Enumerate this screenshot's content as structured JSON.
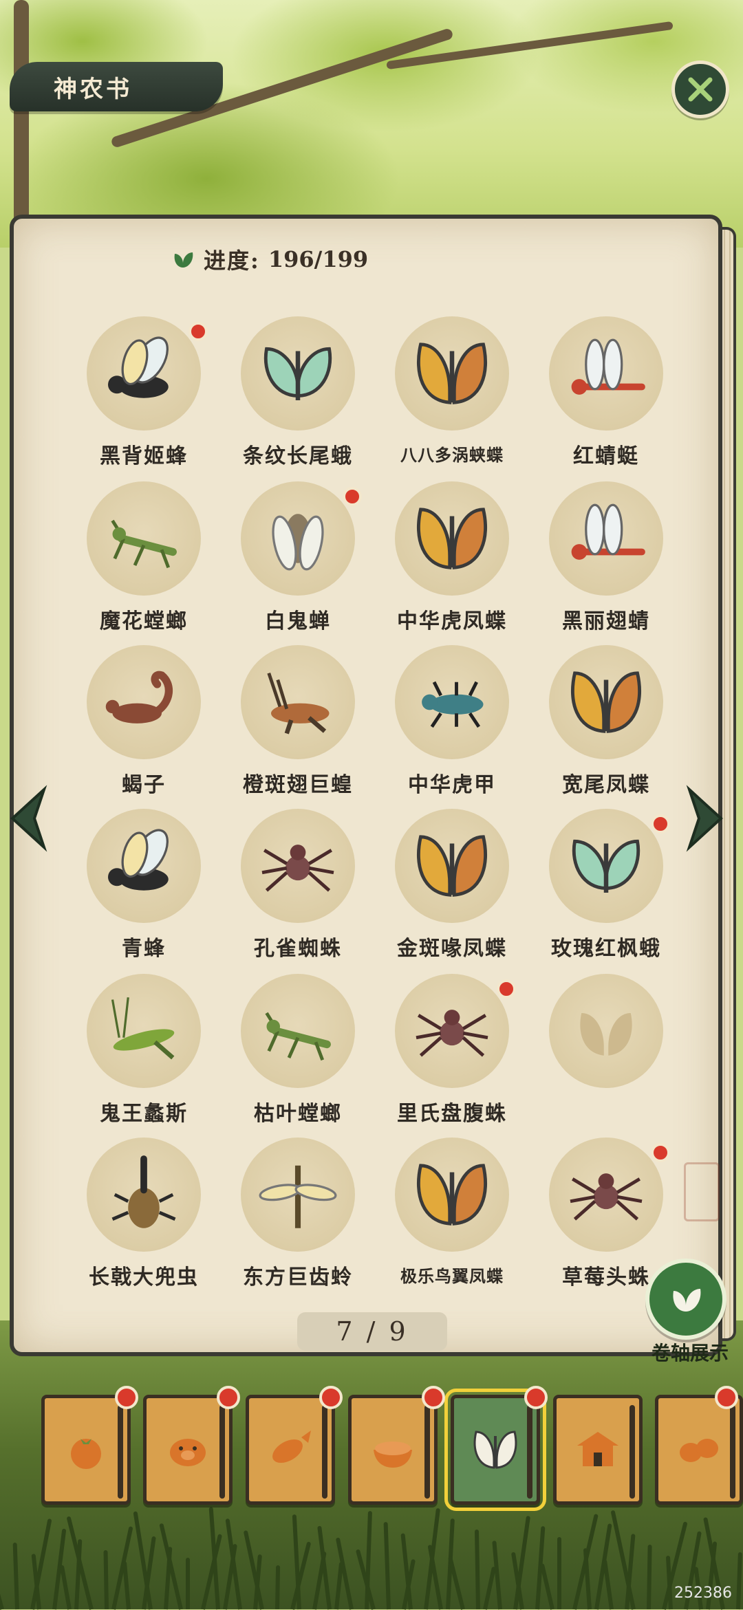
{
  "header": {
    "title": "神农书"
  },
  "progress": {
    "label": "进度:",
    "value": "196/199"
  },
  "grid_items": [
    {
      "label": "黑背姬蜂",
      "badge": true,
      "icon": "wasp-icon",
      "small": false
    },
    {
      "label": "条纹长尾蛾",
      "badge": false,
      "icon": "moth-icon",
      "small": false
    },
    {
      "label": "八八多涡蛱蝶",
      "badge": false,
      "icon": "butterfly-icon",
      "small": true
    },
    {
      "label": "红蜻蜓",
      "badge": false,
      "icon": "dragonfly-icon",
      "small": false
    },
    {
      "label": "魔花螳螂",
      "badge": false,
      "icon": "mantis-icon",
      "small": false
    },
    {
      "label": "白鬼蝉",
      "badge": true,
      "icon": "cicada-icon",
      "small": false
    },
    {
      "label": "中华虎凤蝶",
      "badge": false,
      "icon": "butterfly-icon",
      "small": false
    },
    {
      "label": "黑丽翅蜻",
      "badge": false,
      "icon": "dragonfly-icon",
      "small": false
    },
    {
      "label": "蝎子",
      "badge": false,
      "icon": "scorpion-icon",
      "small": false
    },
    {
      "label": "橙斑翅巨蝗",
      "badge": false,
      "icon": "locust-icon",
      "small": false
    },
    {
      "label": "中华虎甲",
      "badge": false,
      "icon": "beetle-icon",
      "small": false
    },
    {
      "label": "宽尾凤蝶",
      "badge": false,
      "icon": "butterfly-icon",
      "small": false
    },
    {
      "label": "青蜂",
      "badge": false,
      "icon": "wasp-icon",
      "small": false
    },
    {
      "label": "孔雀蜘蛛",
      "badge": false,
      "icon": "spider-icon",
      "small": false
    },
    {
      "label": "金斑喙凤蝶",
      "badge": false,
      "icon": "butterfly-icon",
      "small": false
    },
    {
      "label": "玫瑰红枫蛾",
      "badge": true,
      "icon": "moth-icon",
      "small": false
    },
    {
      "label": "鬼王蠡斯",
      "badge": false,
      "icon": "katydid-icon",
      "small": false
    },
    {
      "label": "枯叶螳螂",
      "badge": false,
      "icon": "mantis-icon",
      "small": false
    },
    {
      "label": "里氏盘腹蛛",
      "badge": true,
      "icon": "spider-icon",
      "small": false
    },
    {
      "label": "",
      "badge": false,
      "icon": "locked-butterfly-icon",
      "small": false
    },
    {
      "label": "长戟大兜虫",
      "badge": false,
      "icon": "rhino-beetle-icon",
      "small": false
    },
    {
      "label": "东方巨齿蛉",
      "badge": false,
      "icon": "dobsonfly-icon",
      "small": false
    },
    {
      "label": "极乐鸟翼凤蝶",
      "badge": false,
      "icon": "butterfly-icon",
      "small": true
    },
    {
      "label": "草莓头蛛",
      "badge": true,
      "icon": "spider-icon",
      "small": false
    }
  ],
  "pagination": {
    "text": "7 / 9"
  },
  "scroll_display": {
    "label": "卷轴展示"
  },
  "tabs": [
    {
      "icon": "persimmon-icon",
      "badge": true,
      "active": false
    },
    {
      "icon": "pig-icon",
      "badge": true,
      "active": false
    },
    {
      "icon": "fish-icon",
      "badge": true,
      "active": false
    },
    {
      "icon": "rice-bowl-icon",
      "badge": true,
      "active": false
    },
    {
      "icon": "butterfly-icon",
      "badge": true,
      "active": true
    },
    {
      "icon": "house-icon",
      "badge": false,
      "active": false
    },
    {
      "icon": "beans-icon",
      "badge": true,
      "active": false
    }
  ],
  "watermark": "252386",
  "colors": {
    "accent_green": "#3c7a3f",
    "badge_red": "#d93a2b",
    "paper": "#efe6d0",
    "tab_gold": "#d9a04d"
  }
}
